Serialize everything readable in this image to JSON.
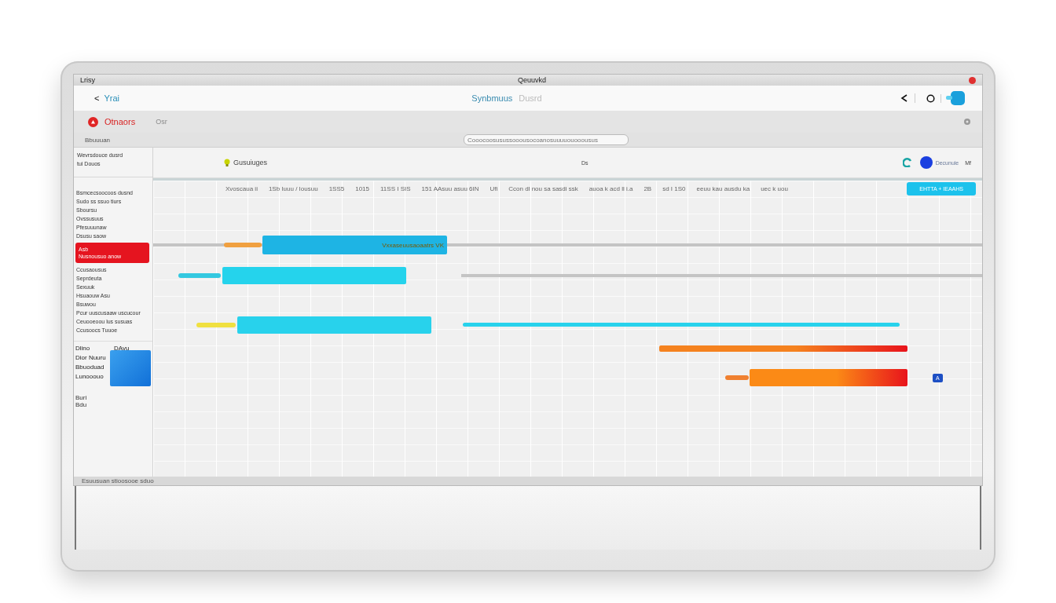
{
  "window": {
    "title": "Lrisy",
    "center_title": "Qeuuvkd"
  },
  "nav": {
    "back": "<",
    "title": "Yrai",
    "center": "Synbmuus",
    "center_muted": "Dusrd"
  },
  "toolbar": {
    "label": "Otnaors",
    "muted": "Osr",
    "sub": "Bbuuuan",
    "search": {
      "placeholder": "Cooocoosusussooousocoanosuuuuouooousus"
    }
  },
  "sidebar": {
    "header": [
      "Wevrsdouce dusrd",
      "tui Douos"
    ],
    "items": [
      {
        "label": "Bsmcecsoocoos dusnd",
        "selected": false
      },
      {
        "label": "Sudo ss ssuo tiurs",
        "selected": false
      },
      {
        "label": "Sboursu",
        "selected": false
      },
      {
        "label": "Ovssusuus",
        "selected": false
      },
      {
        "label": "Pfesuuunaw",
        "selected": false
      },
      {
        "label": "Dsusu saow",
        "selected": false
      },
      {
        "label": "Asb",
        "sub": "Nusnousuo anow",
        "selected": true
      },
      {
        "label": "Ccusaousus",
        "selected": false
      },
      {
        "label": "Seprdeuta",
        "selected": false
      },
      {
        "label": "Sexuuk",
        "selected": false
      },
      {
        "label": "Hsuaouw Asu",
        "selected": false
      },
      {
        "label": "Bsuwou",
        "selected": false
      },
      {
        "label": "Pcur uuscusaaw uscucour",
        "selected": false
      },
      {
        "label": "Ceuooeoou lus susuas",
        "selected": false
      },
      {
        "label": "Ccusoocs Tuuoe",
        "selected": false
      }
    ],
    "footer": [
      "Dlino",
      "Dior Nuuru",
      "Bbuoduad",
      "Lunooouo"
    ],
    "tile": "DAvu",
    "tail": [
      "Buri",
      "Bdu"
    ]
  },
  "gantt": {
    "group": "Gusuiuges",
    "mid": "Ds",
    "legend": "Decunuie",
    "legend_tail": "Mf",
    "timeline": [
      "Xvoscaua ii",
      "1Sb Iuuu / Iousuu",
      "1SS5",
      "1015",
      "11SS I SIS",
      "151 AAsuu asuu 6IN",
      "Ufi",
      "Ccon dl nou sa sasdi ssk",
      "auoa k acd ll i.a",
      "2B",
      "sd I 1S0",
      "eeuu kau ausdu ka",
      "uec k uou"
    ],
    "action": "EHTTA + IEAAHS",
    "tasks": [
      {
        "color": "#1eb4e4",
        "kind": "solid",
        "tag": "Vxxaseuusaoaatrs VK"
      },
      {
        "color": "#25d3ec",
        "kind": "solid"
      },
      {
        "color": "#28d2ec",
        "kind": "solid"
      },
      {
        "color": "#f5821f",
        "kind": "gradient"
      },
      {
        "color": "#fb8a16",
        "kind": "gradient",
        "tag": "A"
      }
    ]
  },
  "status": "Esuusuan stioosooe sduo"
}
